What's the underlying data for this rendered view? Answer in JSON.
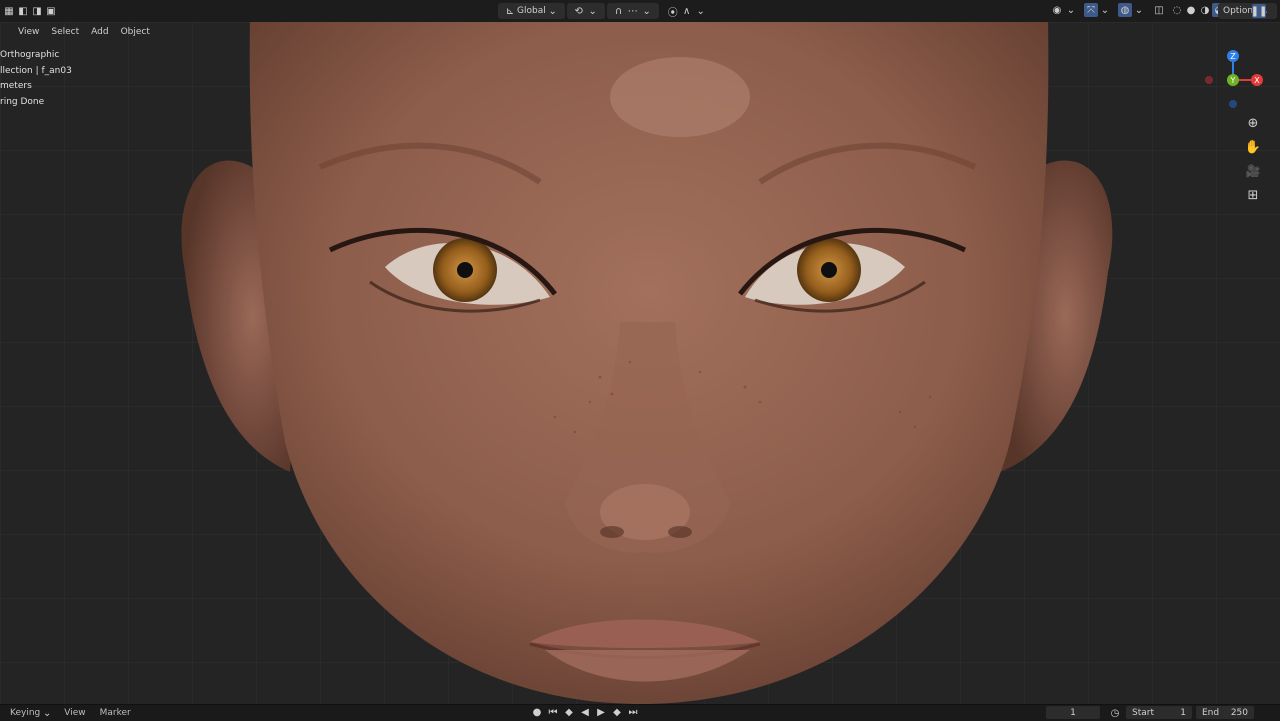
{
  "topbar": {
    "transform_orientation": "Global",
    "options_label": "Options"
  },
  "viewport_header": {
    "menu": [
      "View",
      "Select",
      "Add",
      "Object"
    ]
  },
  "overlay": {
    "lines": [
      "Orthographic",
      "llection | f_an03",
      "meters",
      "ring Done"
    ]
  },
  "timeline": {
    "menus": [
      "Keying",
      "View",
      "Marker"
    ],
    "current_frame": "1",
    "start_label": "Start",
    "start_value": "1",
    "end_label": "End",
    "end_value": "250"
  },
  "gizmo": {
    "axes": [
      "Z",
      "Y",
      "X"
    ],
    "colors": {
      "x": "#e23b3b",
      "y": "#6fb324",
      "z": "#2f7fe8"
    }
  }
}
